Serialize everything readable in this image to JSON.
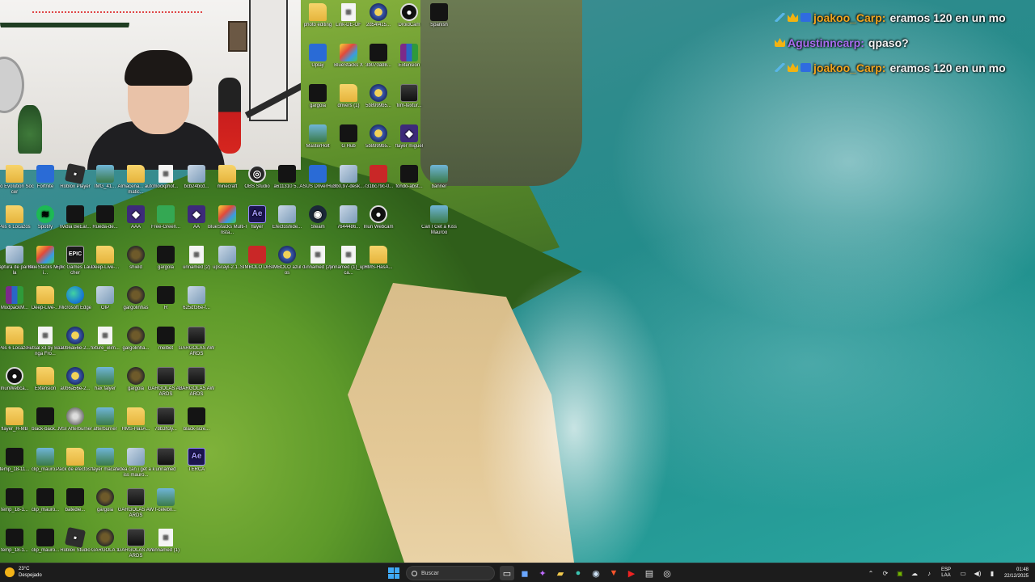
{
  "chat": [
    {
      "badges": [
        "sword-icon",
        "crown-icon",
        "sub-icon"
      ],
      "user": "joakoo_Carp:",
      "user_color": "#f2a51f",
      "message": "eramos 120 en un mo"
    },
    {
      "badges": [
        "crown-icon"
      ],
      "user": "Agustinncarp:",
      "user_color": "#a86cf0",
      "message": "qpaso?"
    },
    {
      "badges": [
        "sword-icon",
        "crown-icon",
        "sub-icon"
      ],
      "user": "joakoo_Carp:",
      "user_color": "#f2a51f",
      "message": "eramos 120 en un mo"
    }
  ],
  "desktop_icons": [
    {
      "label": "photo editing",
      "icon": "folder"
    },
    {
      "label": "Link-DE-OF",
      "icon": "doc"
    },
    {
      "label": "2d54f415...",
      "icon": "gold"
    },
    {
      "label": "DroidCam",
      "icon": "cam"
    },
    {
      "label": "Spanish",
      "icon": "black"
    },
    {
      "label": "Uplay",
      "icon": "blue"
    },
    {
      "label": "BlueStacks X",
      "icon": "bluestack"
    },
    {
      "label": "3b070a98...",
      "icon": "black"
    },
    {
      "label": "Extension",
      "icon": "winrar"
    },
    {
      "label": "gargola",
      "icon": "black"
    },
    {
      "label": "drivers (1)",
      "icon": "folder"
    },
    {
      "label": "5b8999b5...",
      "icon": "gold"
    },
    {
      "label": "film-textur...",
      "icon": "film"
    },
    {
      "label": "MasterHolt",
      "icon": "img"
    },
    {
      "label": "G Hub",
      "icon": "black"
    },
    {
      "label": "5b8999b5...",
      "icon": "gold"
    },
    {
      "label": "flayer miguel",
      "icon": "purple"
    },
    {
      "label": "ASUS DriverHub",
      "icon": "blue"
    },
    {
      "label": "3b0,97-desk...",
      "icon": "photo"
    },
    {
      "label": "731bc79c-0...",
      "icon": "red"
    },
    {
      "label": "fondo-abst...",
      "icon": "black"
    },
    {
      "label": "banner",
      "icon": "img"
    },
    {
      "label": "Steam",
      "icon": "steam"
    },
    {
      "label": "7644486...",
      "icon": "photo"
    },
    {
      "label": "Iriun Webcam",
      "icon": "cam"
    },
    {
      "label": "Can I Get a Kiss Mauroo",
      "icon": "img"
    },
    {
      "label": "unnamed (2)",
      "icon": "doc"
    },
    {
      "label": "unnamed (1)_upsca...",
      "icon": "doc"
    },
    {
      "label": "HMS-HasA...",
      "icon": "folder"
    },
    {
      "label": "Pro Evolution Soccer",
      "icon": "folder"
    },
    {
      "label": "Fortnite",
      "icon": "blue"
    },
    {
      "label": "Roblox Player",
      "icon": "roblox"
    },
    {
      "label": "IMG_41...",
      "icon": "img"
    },
    {
      "label": "Almacena... automatic...",
      "icon": "folder"
    },
    {
      "label": "mockphot...",
      "icon": "doc"
    },
    {
      "label": "bcb24bcd...",
      "icon": "photo"
    },
    {
      "label": "minecraft",
      "icon": "folder"
    },
    {
      "label": "OBS Studio",
      "icon": "obs"
    },
    {
      "label": "a611310 5...",
      "icon": "black"
    },
    {
      "label": "Pes 6 Locazos",
      "icon": "folder"
    },
    {
      "label": "Spotify",
      "icon": "spot"
    },
    {
      "label": "nvidia BeEar...",
      "icon": "black"
    },
    {
      "label": "Rueda-de...",
      "icon": "black"
    },
    {
      "label": "AAA",
      "icon": "purple"
    },
    {
      "label": "Free-Green...",
      "icon": "green"
    },
    {
      "label": "AA",
      "icon": "purple"
    },
    {
      "label": "BlueStacks Multi-Insta...",
      "icon": "bluestack"
    },
    {
      "label": "flayer",
      "icon": "ae"
    },
    {
      "label": "Efectoshide...",
      "icon": "photo"
    },
    {
      "label": "Captura de pantalla",
      "icon": "photo"
    },
    {
      "label": "BlueStacks Multi...",
      "icon": "bluestack"
    },
    {
      "label": "Epic Games Launcher",
      "icon": "epic"
    },
    {
      "label": "Deep-Live-...",
      "icon": "folder"
    },
    {
      "label": "shield",
      "icon": "shield"
    },
    {
      "label": "gargola",
      "icon": "black"
    },
    {
      "label": "unnamed (2)",
      "icon": "doc"
    },
    {
      "label": "upscayl-2.1...",
      "icon": "photo"
    },
    {
      "label": "SIMBOLO DE...",
      "icon": "red"
    },
    {
      "label": "SIMBOLO azul dos",
      "icon": "gold"
    },
    {
      "label": "ModpackM...",
      "icon": "winrar"
    },
    {
      "label": "Deep-Live-...",
      "icon": "folder"
    },
    {
      "label": "Microsoft Edge",
      "icon": "edge"
    },
    {
      "label": "OIP",
      "icon": "photo"
    },
    {
      "label": "gargolinhas",
      "icon": "shield"
    },
    {
      "label": "R",
      "icon": "black"
    },
    {
      "label": "625df36e-f...",
      "icon": "photo"
    },
    {
      "label": "Pes 6 Locazos",
      "icon": "folder"
    },
    {
      "label": "Futsal x3 by Bazinga Fro...",
      "icon": "doc"
    },
    {
      "label": "a0b6a56e-2...",
      "icon": "gold"
    },
    {
      "label": "fixture_elim...",
      "icon": "doc"
    },
    {
      "label": "gargolinha...",
      "icon": "shield"
    },
    {
      "label": "melbet",
      "icon": "black"
    },
    {
      "label": "GARGOLAS AWARDS",
      "icon": "film"
    },
    {
      "label": "IriunWebca...",
      "icon": "cam"
    },
    {
      "label": "Extension",
      "icon": "folder"
    },
    {
      "label": "a0b6a56e-2...",
      "icon": "gold"
    },
    {
      "label": "hax falyer",
      "icon": "img"
    },
    {
      "label": "gargola",
      "icon": "shield"
    },
    {
      "label": "GARGOLAS AWARDS",
      "icon": "film"
    },
    {
      "label": "GARGOLAS AWARDS",
      "icon": "film"
    },
    {
      "label": "flayer_H-MB",
      "icon": "folder"
    },
    {
      "label": "black-back...",
      "icon": "black"
    },
    {
      "label": "MSI Afterburner",
      "icon": "msi"
    },
    {
      "label": "afterburner",
      "icon": "img"
    },
    {
      "label": "HMS-HasA...",
      "icon": "folder"
    },
    {
      "label": "78b3h3y...",
      "icon": "film"
    },
    {
      "label": "black-scre...",
      "icon": "black"
    },
    {
      "label": "temp_18-11...",
      "icon": "black"
    },
    {
      "label": "clip_mauro...",
      "icon": "img"
    },
    {
      "label": "Pack de efectos...",
      "icon": "folder"
    },
    {
      "label": "flayer macata",
      "icon": "img"
    },
    {
      "label": "vdea can i get a kiss mauro...",
      "icon": "photo"
    },
    {
      "label": "unnamed",
      "icon": "film"
    },
    {
      "label": "TERCA",
      "icon": "ae"
    },
    {
      "label": "temp_18-1...",
      "icon": "black"
    },
    {
      "label": "clip_mauro...",
      "icon": "black"
    },
    {
      "label": "batedie...",
      "icon": "black"
    },
    {
      "label": "gargola",
      "icon": "shield"
    },
    {
      "label": "GARGOLAS AWARDS",
      "icon": "film"
    },
    {
      "label": "f-celebri...",
      "icon": "img"
    },
    {
      "label": "temp_18-1...",
      "icon": "black"
    },
    {
      "label": "clip_mauro...",
      "icon": "black"
    },
    {
      "label": "Roblox Studio",
      "icon": "roblox"
    },
    {
      "label": "GARGOLA 1",
      "icon": "shield"
    },
    {
      "label": "GARGOLAS AWARDS",
      "icon": "film"
    },
    {
      "label": "unnamed (1)",
      "icon": "doc"
    }
  ],
  "taskbar": {
    "weather_temp": "23°C",
    "weather_desc": "Despejado",
    "search_placeholder": "Buscar",
    "apps": [
      "file-explorer-icon",
      "widgets-icon",
      "copilot-icon",
      "folder-icon",
      "edge-icon",
      "steam-icon",
      "brave-icon",
      "youtube-icon",
      "document-icon",
      "obs-icon"
    ],
    "lang_line1": "ESP",
    "lang_line2": "LAA",
    "time": "01:48",
    "date": "22/12/2025"
  }
}
